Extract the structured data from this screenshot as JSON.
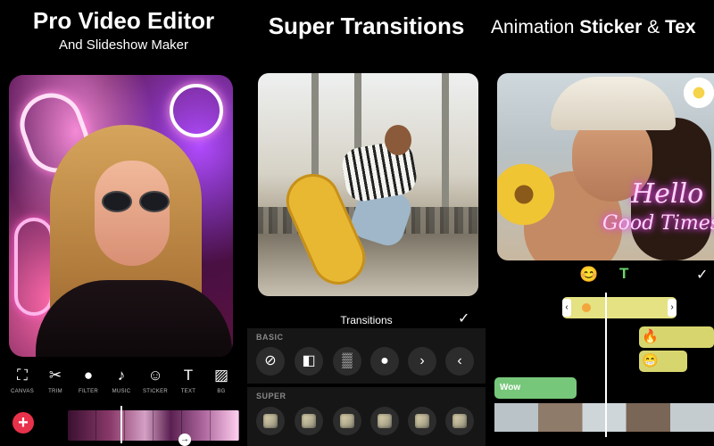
{
  "panel1": {
    "headline": "Pro Video Editor",
    "subhead": "And Slideshow Maker",
    "toolbar": [
      {
        "label": "CANVAS",
        "icon": "canvas-icon",
        "glyph": "⛶"
      },
      {
        "label": "TRIM",
        "icon": "scissors-icon",
        "glyph": "✂"
      },
      {
        "label": "FILTER",
        "icon": "filter-icon",
        "glyph": "●"
      },
      {
        "label": "MUSIC",
        "icon": "music-icon",
        "glyph": "♪"
      },
      {
        "label": "STICKER",
        "icon": "sticker-icon",
        "glyph": "☺"
      },
      {
        "label": "TEXT",
        "icon": "text-icon",
        "glyph": "T"
      },
      {
        "label": "BG",
        "icon": "background-icon",
        "glyph": "▨"
      }
    ],
    "add_glyph": "+",
    "arrow_glyph": "→"
  },
  "panel2": {
    "headline": "Super Transitions",
    "transitions_title": "Transitions",
    "check_glyph": "✓",
    "basic_label": "BASIC",
    "super_label": "SUPER",
    "basic_buttons": [
      {
        "icon": "none-icon",
        "glyph": "⊘"
      },
      {
        "icon": "fade-icon",
        "glyph": "◧"
      },
      {
        "icon": "dissolve-icon",
        "glyph": "▒"
      },
      {
        "icon": "circle-icon",
        "glyph": "●"
      },
      {
        "icon": "chevron-right-icon",
        "glyph": "›"
      },
      {
        "icon": "chevron-left-icon",
        "glyph": "‹"
      }
    ],
    "super_count": 6
  },
  "panel3": {
    "headline_plain1": "Animation ",
    "headline_bold": "Sticker",
    "headline_plain2": " & ",
    "headline_bold2": "Tex",
    "overlay_line1": "Hello",
    "overlay_line2": "Good Times",
    "emoji_tab_glyph": "😊",
    "text_tab_glyph": "T",
    "check_glyph": "✓",
    "clip_fire_glyph": "🔥",
    "clip_face_glyph": "😁",
    "clip_wow_label": "Wow",
    "handle_left": "‹",
    "handle_right": "›"
  },
  "colors": {
    "accent_red": "#e8314a",
    "text_clip": "#d7d66e",
    "wow_clip": "#77c77a",
    "text_tab": "#6cd66c"
  }
}
